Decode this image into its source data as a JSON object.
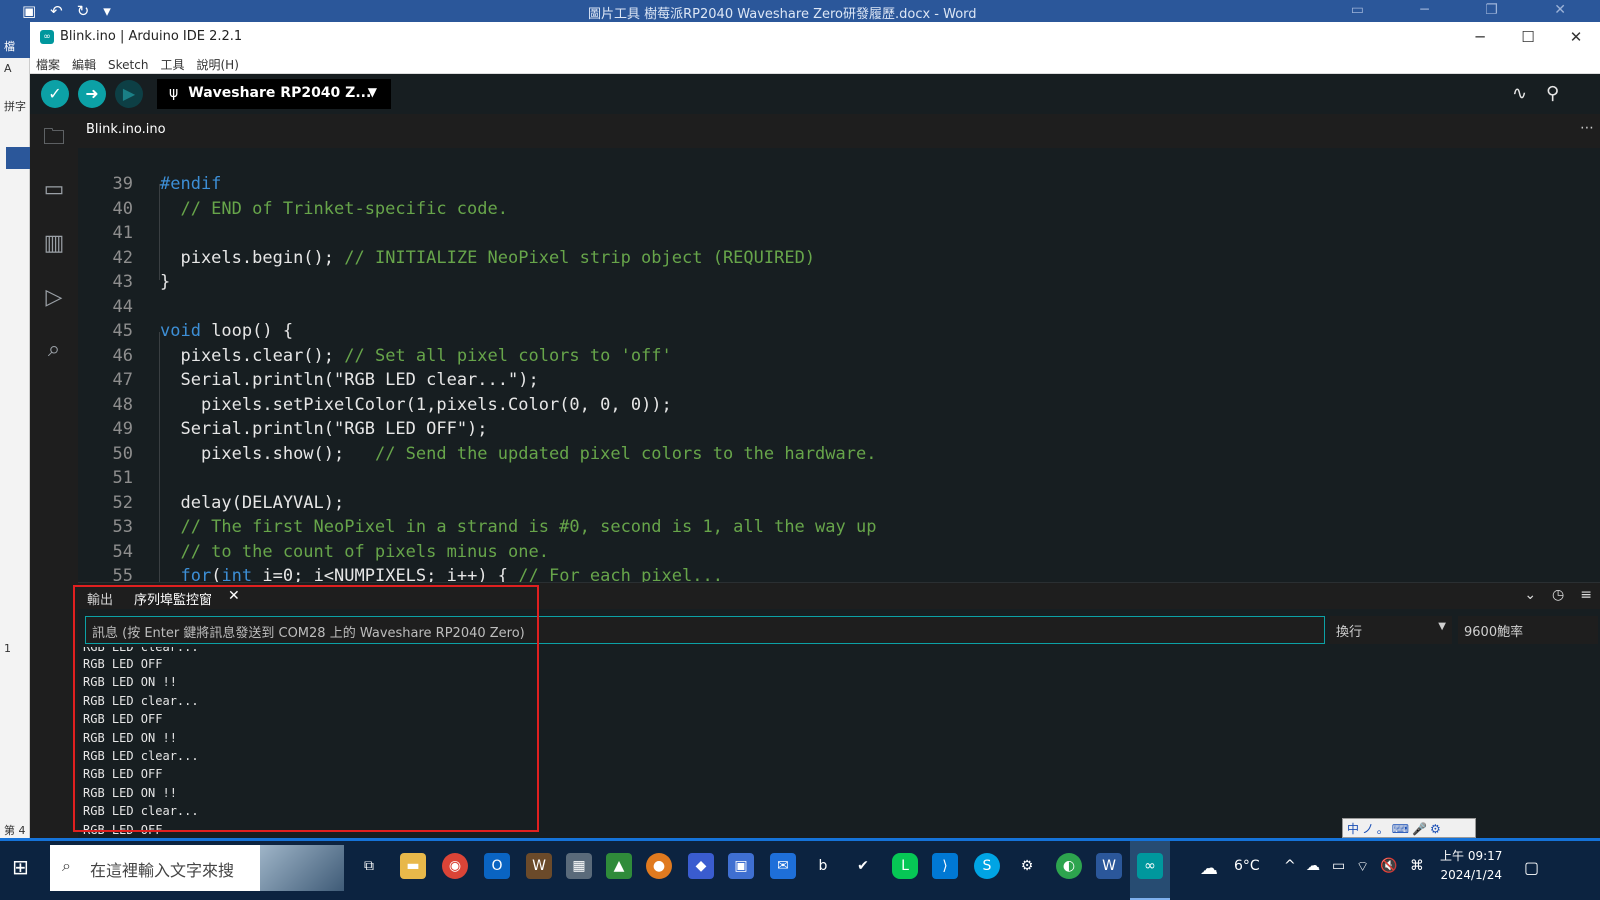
{
  "word": {
    "title": "圖片工具  樹莓派RP2040 Waveshare Zero研發履歷.docx - Word",
    "left_labels": [
      "檔",
      "A",
      "拼字",
      "1",
      "第 4"
    ]
  },
  "window": {
    "title": "Blink.ino | Arduino IDE 2.2.1"
  },
  "menu": [
    "檔案",
    "編輯",
    "Sketch",
    "工具",
    "說明(H)"
  ],
  "toolbar": {
    "board": "Waveshare RP2040 Z..."
  },
  "tab": {
    "filename": "Blink.ino.ino"
  },
  "code": [
    {
      "n": "39",
      "html": "#endif",
      "indent": 0,
      "cls": "cm"
    },
    {
      "n": "40",
      "text": "  // END of Trinket-specific code.",
      "cls": "cm"
    },
    {
      "n": "41",
      "text": ""
    },
    {
      "n": "42",
      "parts": [
        [
          "  pixels",
          "kw2"
        ],
        [
          ".begin();",
          ""
        ],
        [
          " // INITIALIZE NeoPixel strip object (REQUIRED)",
          "cm"
        ]
      ]
    },
    {
      "n": "43",
      "text": "}"
    },
    {
      "n": "44",
      "text": ""
    },
    {
      "n": "45",
      "parts": [
        [
          "void",
          "kw"
        ],
        [
          " loop() {",
          ""
        ]
      ]
    },
    {
      "n": "46",
      "parts": [
        [
          "  pixels",
          "kw2"
        ],
        [
          ".clear();",
          ""
        ],
        [
          " // Set all pixel colors to 'off'",
          "cm"
        ]
      ]
    },
    {
      "n": "47",
      "parts": [
        [
          "  Serial",
          "kw2"
        ],
        [
          ".println(\"RGB LED clear...\");",
          ""
        ]
      ]
    },
    {
      "n": "48",
      "parts": [
        [
          "    pixels",
          "kw2"
        ],
        [
          ".setPixelColor(1,",
          ""
        ],
        [
          "pixels",
          "kw2"
        ],
        [
          ".Color(0, 0, 0));",
          ""
        ]
      ]
    },
    {
      "n": "49",
      "parts": [
        [
          "  Serial",
          "kw2"
        ],
        [
          ".println(\"RGB LED OFF\");",
          ""
        ]
      ]
    },
    {
      "n": "50",
      "parts": [
        [
          "    pixels",
          "kw2"
        ],
        [
          ".show();",
          ""
        ],
        [
          "   // Send the updated pixel colors to the hardware.",
          "cm"
        ]
      ]
    },
    {
      "n": "51",
      "text": ""
    },
    {
      "n": "52",
      "text": "  delay(DELAYVAL);"
    },
    {
      "n": "53",
      "text": "  // The first NeoPixel in a strand is #0, second is 1, all the way up",
      "cls": "cm"
    },
    {
      "n": "54",
      "text": "  // to the count of pixels minus one.",
      "cls": "cm"
    },
    {
      "n": "55",
      "parts": [
        [
          "  for",
          "kw"
        ],
        [
          "(",
          ""
        ],
        [
          "int",
          "kw"
        ],
        [
          " i=0; i<NUMPIXELS; i++) {",
          ""
        ],
        [
          " // For each pixel...",
          "cm"
        ]
      ]
    }
  ],
  "panel": {
    "tab_output": "輸出",
    "tab_serial": "序列埠監控窗",
    "message_placeholder": "訊息 (按 Enter 鍵將訊息發送到 COM28 上的 Waveshare RP2040 Zero)",
    "line_ending": "換行",
    "baud": "9600鮑率",
    "serial_lines": [
      "RGB LED clear...",
      "RGB LED OFF",
      "RGB LED ON !!",
      "RGB LED clear...",
      "RGB LED OFF",
      "RGB LED ON !!",
      "RGB LED clear...",
      "RGB LED OFF",
      "RGB LED ON !!",
      "RGB LED clear...",
      "RGB LED OFF"
    ]
  },
  "taskbar": {
    "search_placeholder": "在這裡輸入文字來搜",
    "weather": "6°C",
    "time": "上午 09:17",
    "date": "2024/1/24"
  },
  "ime": "中ノ。⌨🎤⚙",
  "colors": {
    "accent": "#0ca1a6",
    "highlight": "#e02020",
    "taskbar": "#0c2340"
  }
}
